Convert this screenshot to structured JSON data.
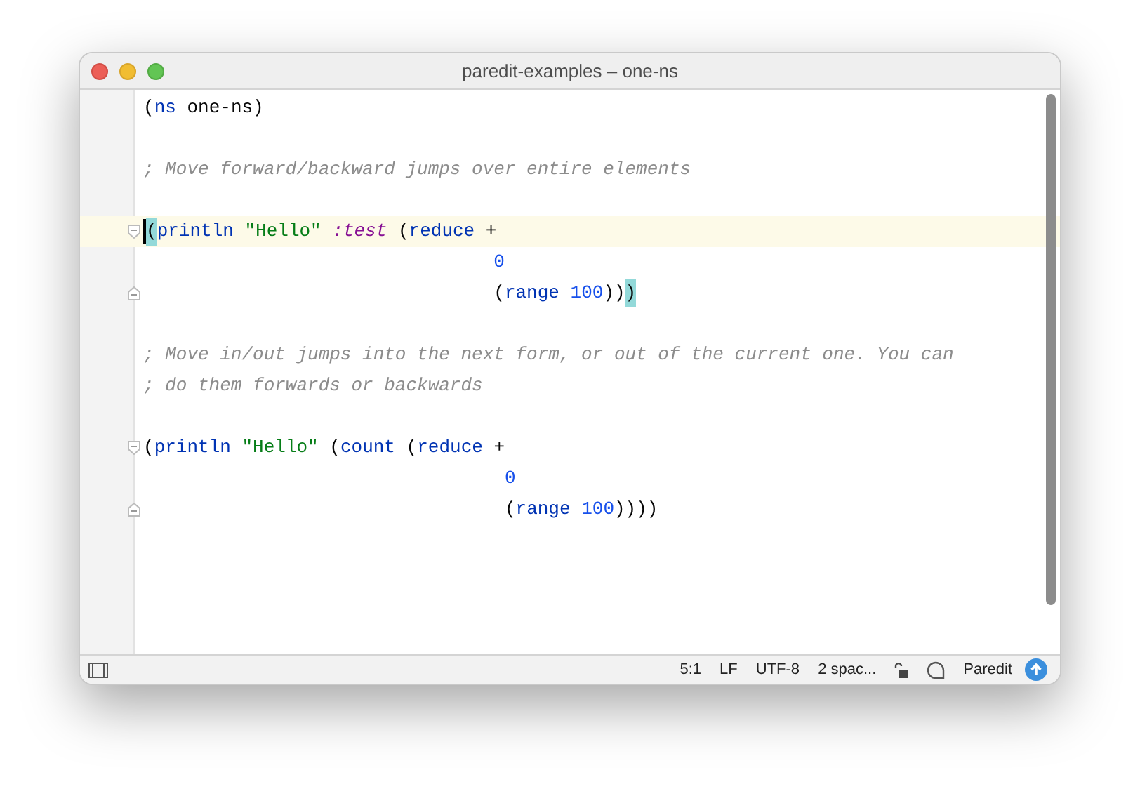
{
  "window": {
    "title": "paredit-examples – one-ns"
  },
  "editor": {
    "lines": [
      {
        "kind": "code",
        "current": false,
        "tokens": [
          {
            "text": "(",
            "kind": "plain"
          },
          {
            "text": "ns",
            "kind": "symbol"
          },
          {
            "text": " one-ns)",
            "kind": "plain"
          }
        ]
      },
      {
        "kind": "blank",
        "current": false
      },
      {
        "kind": "code",
        "current": false,
        "tokens": [
          {
            "text": "; Move forward/backward jumps over entire elements",
            "kind": "comment"
          }
        ]
      },
      {
        "kind": "blank",
        "current": false
      },
      {
        "kind": "fold-start",
        "current": true,
        "caret": true,
        "tokens": [
          {
            "text": "(",
            "kind": "plain",
            "matched": true
          },
          {
            "text": "println",
            "kind": "symbol"
          },
          {
            "text": " \"Hello\"",
            "kind": "string"
          },
          {
            "text": " :test",
            "kind": "keyword"
          },
          {
            "text": " (",
            "kind": "plain"
          },
          {
            "text": "reduce",
            "kind": "symbol"
          },
          {
            "text": " +",
            "kind": "plain"
          }
        ]
      },
      {
        "kind": "code",
        "current": false,
        "tokens": [
          {
            "text": "                                0",
            "kind": "number"
          }
        ]
      },
      {
        "kind": "fold-end",
        "current": false,
        "tokens": [
          {
            "text": "                                (",
            "kind": "plain"
          },
          {
            "text": "range",
            "kind": "symbol"
          },
          {
            "text": " 100",
            "kind": "number"
          },
          {
            "text": "))",
            "kind": "plain"
          },
          {
            "text": ")",
            "kind": "plain",
            "matched": true
          }
        ]
      },
      {
        "kind": "blank",
        "current": false
      },
      {
        "kind": "code",
        "current": false,
        "tokens": [
          {
            "text": "; Move in/out jumps into the next form, or out of the current one. You can",
            "kind": "comment"
          }
        ]
      },
      {
        "kind": "code",
        "current": false,
        "tokens": [
          {
            "text": "; do them forwards or backwards",
            "kind": "comment"
          }
        ]
      },
      {
        "kind": "blank",
        "current": false
      },
      {
        "kind": "fold-start",
        "current": false,
        "tokens": [
          {
            "text": "(",
            "kind": "plain"
          },
          {
            "text": "println",
            "kind": "symbol"
          },
          {
            "text": " \"Hello\"",
            "kind": "string"
          },
          {
            "text": " (",
            "kind": "plain"
          },
          {
            "text": "count",
            "kind": "symbol"
          },
          {
            "text": " (",
            "kind": "plain"
          },
          {
            "text": "reduce",
            "kind": "symbol"
          },
          {
            "text": " +",
            "kind": "plain"
          }
        ]
      },
      {
        "kind": "code",
        "current": false,
        "tokens": [
          {
            "text": "                                 0",
            "kind": "number"
          }
        ]
      },
      {
        "kind": "fold-end",
        "current": false,
        "tokens": [
          {
            "text": "                                 (",
            "kind": "plain"
          },
          {
            "text": "range",
            "kind": "symbol"
          },
          {
            "text": " 100",
            "kind": "number"
          },
          {
            "text": "))))",
            "kind": "plain"
          }
        ]
      }
    ]
  },
  "status_bar": {
    "items": [
      "5:1",
      "LF",
      "UTF-8",
      "2 spac..."
    ],
    "mode": "Paredit"
  }
}
